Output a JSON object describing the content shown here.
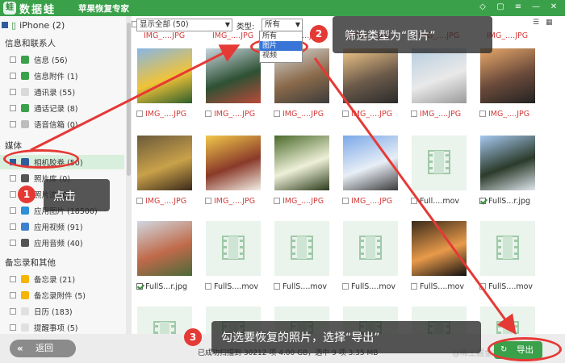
{
  "app": {
    "brand": "数据蛙",
    "subtitle": "苹果恢复专家",
    "logo_glyph": "蛙"
  },
  "titlebar_icons": [
    "gem-icon",
    "chat-icon",
    "menu-icon",
    "minimize-icon",
    "close-icon"
  ],
  "sidebar": {
    "device": "iPhone (2)",
    "sections": [
      {
        "title": "信息和联系人",
        "items": [
          {
            "label": "信息 (56)",
            "color": "#3aa14a",
            "state": "empty"
          },
          {
            "label": "信息附件 (1)",
            "color": "#3aa14a",
            "state": "empty"
          },
          {
            "label": "通讯录 (55)",
            "color": "#d9d9d9",
            "state": "empty"
          },
          {
            "label": "通话记录 (8)",
            "color": "#3aa14a",
            "state": "empty"
          },
          {
            "label": "语音信箱 (0)",
            "color": "#bdbdbd",
            "state": "empty"
          }
        ]
      },
      {
        "title": "媒体",
        "items": [
          {
            "label": "相机胶卷 (50)",
            "color": "#2f5c9d",
            "state": "filled",
            "active": true
          },
          {
            "label": "照片库 (0)",
            "color": "#555555",
            "state": "empty"
          },
          {
            "label": "照片流 (0)",
            "color": "#ff6a6a",
            "state": "empty"
          },
          {
            "label": "应用图片 (18500)",
            "color": "#2f8fd8",
            "state": "empty"
          },
          {
            "label": "应用视频 (91)",
            "color": "#3f7fd0",
            "state": "empty"
          },
          {
            "label": "应用音频 (40)",
            "color": "#555555",
            "state": "empty"
          }
        ]
      },
      {
        "title": "备忘录和其他",
        "items": [
          {
            "label": "备忘录 (21)",
            "color": "#f5b400",
            "state": "empty"
          },
          {
            "label": "备忘录附件 (5)",
            "color": "#f5b400",
            "state": "empty"
          },
          {
            "label": "日历 (183)",
            "color": "#e0e0e0",
            "state": "empty"
          },
          {
            "label": "提醒事项 (5)",
            "color": "#e0e0e0",
            "state": "empty"
          }
        ]
      }
    ]
  },
  "filter": {
    "show": "显示全部 (50)",
    "type_label": "类型:",
    "type_value": "所有",
    "options": [
      "所有",
      "图片",
      "视频"
    ],
    "highlighted_option": "图片"
  },
  "view_icons": [
    "list-view-icon",
    "grid-view-icon"
  ],
  "grid": {
    "top_captions": [
      "IMG_....JPG",
      "IMG_....JPG",
      "IMG_....JPG",
      "IMG_....JPG",
      "IMG_....JPG",
      "IMG_....JPG"
    ],
    "rows": [
      [
        {
          "kind": "photo",
          "caption": "IMG_....JPG",
          "checked": false,
          "red": true,
          "colors": [
            "#87b6e6",
            "#f0c338",
            "#2c5e2c"
          ]
        },
        {
          "kind": "photo",
          "caption": "IMG_....JPG",
          "checked": false,
          "red": true,
          "colors": [
            "#c9d6df",
            "#2e5134",
            "#b94a3a"
          ]
        },
        {
          "kind": "photo",
          "caption": "IMG_....JPG",
          "checked": false,
          "red": true,
          "colors": [
            "#d8d8d8",
            "#8a6a4a",
            "#3c3c3c"
          ]
        },
        {
          "kind": "photo",
          "caption": "IMG_....JPG",
          "checked": false,
          "red": true,
          "colors": [
            "#f4c98a",
            "#6b5a4a",
            "#2b2b2b"
          ]
        },
        {
          "kind": "photo",
          "caption": "IMG_....JPG",
          "checked": false,
          "red": true,
          "colors": [
            "#b6cde0",
            "#e9e9e9",
            "#9a9a9a"
          ]
        },
        {
          "kind": "photo",
          "caption": "IMG_....JPG",
          "checked": false,
          "red": true,
          "colors": [
            "#e8a86a",
            "#6a4a3a",
            "#222222"
          ]
        }
      ],
      [
        {
          "kind": "photo",
          "caption": "IMG_....JPG",
          "checked": false,
          "red": true,
          "colors": [
            "#6b5a3a",
            "#c9a14a",
            "#3a2a1a"
          ]
        },
        {
          "kind": "photo",
          "caption": "IMG_....JPG",
          "checked": false,
          "red": true,
          "colors": [
            "#f2c84a",
            "#8a3a2a",
            "#f4efe6"
          ]
        },
        {
          "kind": "photo",
          "caption": "IMG_....JPG",
          "checked": false,
          "red": true,
          "colors": [
            "#4a6a2a",
            "#eef0d8",
            "#2a3a1a"
          ]
        },
        {
          "kind": "photo",
          "caption": "IMG_....JPG",
          "checked": false,
          "red": true,
          "colors": [
            "#7aa8e8",
            "#e8eef6",
            "#3a3a3a"
          ]
        },
        {
          "kind": "video",
          "caption": "Full....mov",
          "checked": false,
          "red": false
        },
        {
          "kind": "photo",
          "caption": "FullS...r.jpg",
          "checked": true,
          "red": false,
          "colors": [
            "#a7c8f0",
            "#2b3b2b",
            "#e0e6ee"
          ]
        }
      ],
      [
        {
          "kind": "photo",
          "caption": "FullS...r.jpg",
          "checked": true,
          "red": false,
          "colors": [
            "#d0d8e0",
            "#c06a4a",
            "#4a6a3a"
          ]
        },
        {
          "kind": "video",
          "caption": "FullS....mov",
          "checked": false,
          "red": false
        },
        {
          "kind": "video",
          "caption": "FullS....mov",
          "checked": false,
          "red": false
        },
        {
          "kind": "video",
          "caption": "FullS....mov",
          "checked": false,
          "red": false
        },
        {
          "kind": "photo",
          "caption": "FullS....mov",
          "checked": false,
          "red": false,
          "colors": [
            "#3a2a1a",
            "#e89a4a",
            "#111111"
          ]
        },
        {
          "kind": "video",
          "caption": "FullS....mov",
          "checked": false,
          "red": false
        }
      ],
      [
        {
          "kind": "video",
          "caption": "",
          "checked": false,
          "red": false
        },
        {
          "kind": "video",
          "caption": "",
          "checked": false,
          "red": false
        },
        {
          "kind": "video",
          "caption": "",
          "checked": false,
          "red": false
        },
        {
          "kind": "video",
          "caption": "",
          "checked": false,
          "red": false
        },
        {
          "kind": "video",
          "caption": "",
          "checked": false,
          "red": false
        },
        {
          "kind": "video",
          "caption": "",
          "checked": false,
          "red": false
        }
      ]
    ]
  },
  "bottom": {
    "back_label": "返回",
    "status": "已成功扫描到 30212 项 4.00 GB，选中 9 项 3.35 MB",
    "export_label": "导出",
    "watermark": "@稀土掘金技术社区"
  },
  "annotations": {
    "step1": {
      "num": "1",
      "text": "点击"
    },
    "step2": {
      "num": "2",
      "text": "筛选类型为“图片”"
    },
    "step3": {
      "num": "3",
      "text": "勾选要恢复的照片，选择“导出”"
    },
    "accent": "#e53935"
  }
}
